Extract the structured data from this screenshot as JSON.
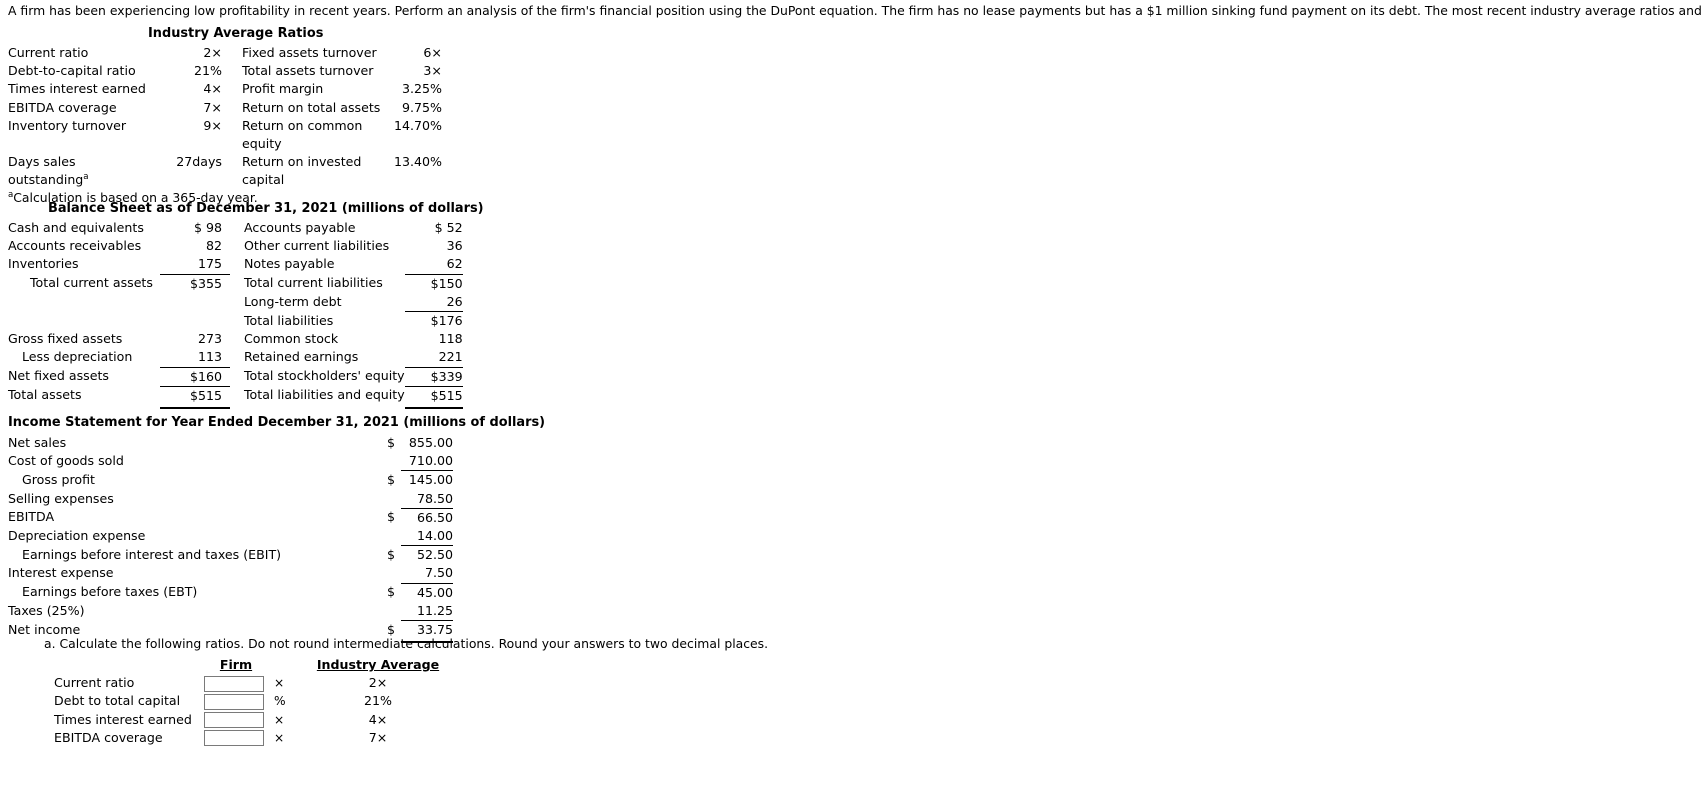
{
  "intro": "A firm has been experiencing low profitability in recent years. Perform an analysis of the firm's financial position using the DuPont equation. The firm has no lease payments but has a $1 million sinking fund payment on its debt. The most recent industry average ratios and the firm's financial statements are as",
  "industry_ratios": {
    "title": "Industry Average Ratios",
    "left_rows": [
      {
        "label": "Current ratio",
        "value": "2×"
      },
      {
        "label": "Debt-to-capital ratio",
        "value": "21%"
      },
      {
        "label": "Times interest earned",
        "value": "4×"
      },
      {
        "label": "EBITDA coverage",
        "value": "7×"
      },
      {
        "label": "Inventory turnover",
        "value": "9×"
      },
      {
        "label": "",
        "value": ""
      },
      {
        "label": "Days sales",
        "value": "27days"
      },
      {
        "label": "outstanding",
        "value": "",
        "sup": "a"
      }
    ],
    "right_rows": [
      {
        "label": "Fixed assets turnover",
        "value": "6×"
      },
      {
        "label": "Total assets turnover",
        "value": "3×"
      },
      {
        "label": "Profit margin",
        "value": "3.25%"
      },
      {
        "label": "Return on total assets",
        "value": "9.75%"
      },
      {
        "label": "Return on common",
        "value": "14.70%"
      },
      {
        "label": "equity",
        "value": ""
      },
      {
        "label": "Return on invested",
        "value": "13.40%"
      },
      {
        "label": "capital",
        "value": ""
      }
    ],
    "footnote": "Calculation is based on a 365-day year.",
    "footnote_marker": "a"
  },
  "balance_sheet": {
    "title": "Balance Sheet as of December 31, 2021 (millions of dollars)",
    "left_rows": [
      {
        "label": "Cash and equivalents",
        "value": "$  98",
        "indent": 0,
        "rule": "none"
      },
      {
        "label": "Accounts receivables",
        "value": "82",
        "indent": 0,
        "rule": "none"
      },
      {
        "label": "Inventories",
        "value": "175",
        "indent": 0,
        "rule": "under"
      },
      {
        "label": "Total current assets",
        "value": "$355",
        "indent": 1,
        "rule": "none"
      },
      {
        "label": "",
        "value": "",
        "indent": 0,
        "rule": "none"
      },
      {
        "label": "",
        "value": "",
        "indent": 0,
        "rule": "none"
      },
      {
        "label": "Gross fixed assets",
        "value": "273",
        "indent": 0,
        "rule": "none"
      },
      {
        "label": "Less depreciation",
        "value": "113",
        "indent": 1,
        "rule": "under"
      },
      {
        "label": "Net fixed assets",
        "value": "$160",
        "indent": 0,
        "rule": "under"
      },
      {
        "label": "Total assets",
        "value": "$515",
        "indent": 0,
        "rule": "double"
      }
    ],
    "right_rows": [
      {
        "label": "Accounts payable",
        "value": "$  52",
        "indent": 0,
        "rule": "none"
      },
      {
        "label": "Other current liabilities",
        "value": "36",
        "indent": 0,
        "rule": "none"
      },
      {
        "label": "Notes payable",
        "value": "62",
        "indent": 0,
        "rule": "under"
      },
      {
        "label": "Total current liabilities",
        "value": "$150",
        "indent": 1,
        "rule": "none"
      },
      {
        "label": "Long-term debt",
        "value": "26",
        "indent": 0,
        "rule": "under"
      },
      {
        "label": "Total liabilities",
        "value": "$176",
        "indent": 1,
        "rule": "none"
      },
      {
        "label": "Common stock",
        "value": "118",
        "indent": 0,
        "rule": "none"
      },
      {
        "label": "Retained earnings",
        "value": "221",
        "indent": 0,
        "rule": "under"
      },
      {
        "label": "Total stockholders' equity",
        "value": "$339",
        "indent": 1,
        "rule": "under"
      },
      {
        "label": "Total liabilities and equity",
        "value": "$515",
        "indent": 0,
        "rule": "double"
      }
    ]
  },
  "income_statement": {
    "title": "Income Statement for Year Ended December 31, 2021 (millions of dollars)",
    "rows": [
      {
        "label": "Net sales",
        "currency": "$",
        "value": "855.00",
        "indent": 0,
        "rule": "none"
      },
      {
        "label": "Cost of goods sold",
        "currency": "",
        "value": "710.00",
        "indent": 0,
        "rule": "under"
      },
      {
        "label": "Gross profit",
        "currency": "$",
        "value": "145.00",
        "indent": 1,
        "rule": "none"
      },
      {
        "label": "Selling expenses",
        "currency": "",
        "value": "78.50",
        "indent": 0,
        "rule": "under"
      },
      {
        "label": "EBITDA",
        "currency": "$",
        "value": "66.50",
        "indent": 0,
        "rule": "none"
      },
      {
        "label": "Depreciation expense",
        "currency": "",
        "value": "14.00",
        "indent": 0,
        "rule": "under"
      },
      {
        "label": "Earnings before interest and taxes (EBIT)",
        "currency": "$",
        "value": "52.50",
        "indent": 1,
        "rule": "none"
      },
      {
        "label": "Interest expense",
        "currency": "",
        "value": "7.50",
        "indent": 0,
        "rule": "under"
      },
      {
        "label": "Earnings before taxes (EBT)",
        "currency": "$",
        "value": "45.00",
        "indent": 1,
        "rule": "none"
      },
      {
        "label": "Taxes (25%)",
        "currency": "",
        "value": "11.25",
        "indent": 0,
        "rule": "under"
      },
      {
        "label": "Net income",
        "currency": "$",
        "value": "33.75",
        "indent": 0,
        "rule": "double"
      }
    ]
  },
  "part_a": {
    "prompt": "a. Calculate the following ratios. Do not round intermediate calculations. Round your answers to two decimal places.",
    "headers": {
      "firm": "Firm",
      "industry": "Industry Average"
    },
    "rows": [
      {
        "label": "Current ratio",
        "value": "",
        "unit": "×",
        "industry": "2×"
      },
      {
        "label": "Debt to total capital",
        "value": "",
        "unit": "%",
        "industry": "21%"
      },
      {
        "label": "Times interest earned",
        "value": "",
        "unit": "×",
        "industry": "4×"
      },
      {
        "label": "EBITDA coverage",
        "value": "",
        "unit": "×",
        "industry": "7×"
      }
    ]
  }
}
